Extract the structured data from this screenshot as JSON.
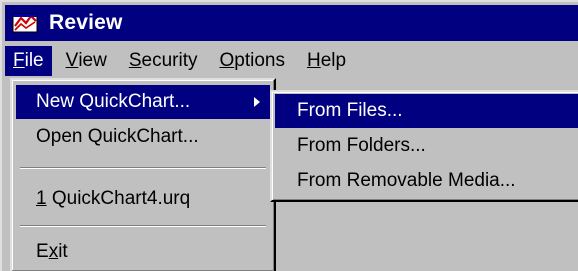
{
  "window": {
    "title": "Review"
  },
  "menubar": {
    "items": [
      {
        "label": "File",
        "accel": "F",
        "rest": "ile"
      },
      {
        "label": "View",
        "accel": "V",
        "rest": "iew"
      },
      {
        "label": "Security",
        "accel": "S",
        "rest": "ecurity"
      },
      {
        "label": "Options",
        "accel": "O",
        "rest": "ptions"
      },
      {
        "label": "Help",
        "accel": "H",
        "rest": "elp"
      }
    ]
  },
  "file_menu": {
    "new_quickchart": "New QuickChart...",
    "open_quickchart": "Open QuickChart...",
    "recent_1_accel": "1",
    "recent_1_rest": " QuickChart4.urq",
    "exit_pre": "E",
    "exit_accel": "x",
    "exit_rest": "it"
  },
  "new_submenu": {
    "items": [
      "From Files...",
      "From Folders...",
      "From Removable Media..."
    ]
  },
  "colors": {
    "highlight": "#000080",
    "face": "#c0c0c0"
  },
  "icons": {
    "app": "review-app-icon",
    "submenu_arrow": "chevron-right-icon"
  }
}
